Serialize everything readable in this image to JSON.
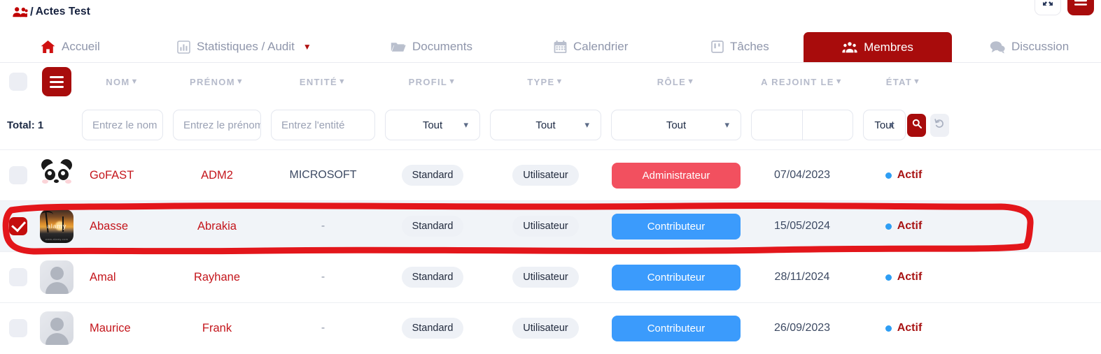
{
  "breadcrumb": {
    "icon": "group-icon",
    "separator": "/",
    "title": "Actes Test"
  },
  "topbar_actions": [
    {
      "name": "fullscreen-button",
      "icon": "expand-arrows-icon"
    },
    {
      "name": "menu-button",
      "icon": "hamburger-icon"
    }
  ],
  "nav": {
    "tabs": [
      {
        "label": "Accueil",
        "icon": "home-icon",
        "active": false,
        "caret": false
      },
      {
        "label": "Statistiques / Audit",
        "icon": "chart-bar-icon",
        "active": false,
        "caret": true
      },
      {
        "label": "Documents",
        "icon": "folder-icon",
        "active": false,
        "caret": false
      },
      {
        "label": "Calendrier",
        "icon": "calendar-icon",
        "active": false,
        "caret": false
      },
      {
        "label": "Tâches",
        "icon": "tasks-icon",
        "active": false,
        "caret": false
      },
      {
        "label": "Membres",
        "icon": "members-icon",
        "active": true,
        "caret": false
      },
      {
        "label": "Discussion",
        "icon": "chat-icon",
        "active": false,
        "caret": false
      }
    ],
    "active_tab_color": "#a80c0c"
  },
  "table": {
    "total_label": "Total: 1",
    "menu_button": "hamburger-icon",
    "columns": [
      {
        "label": "NOM",
        "sortable": true
      },
      {
        "label": "PRÉNOM",
        "sortable": true
      },
      {
        "label": "ENTITÉ",
        "sortable": true
      },
      {
        "label": "PROFIL",
        "sortable": true
      },
      {
        "label": "TYPE",
        "sortable": true
      },
      {
        "label": "RÔLE",
        "sortable": true
      },
      {
        "label": "A REJOINT LE",
        "sortable": true
      },
      {
        "label": "ÉTAT",
        "sortable": true
      }
    ],
    "filters": {
      "nom_placeholder": "Entrez le nom",
      "prenom_placeholder": "Entrez le prénom",
      "entite_placeholder": "Entrez l'entité",
      "profil_value": "Tout",
      "type_value": "Tout",
      "role_value": "Tout",
      "date_from": "",
      "date_to": "",
      "etat_value": "Tout",
      "search_button": "search-icon",
      "reset_button": "undo-icon"
    },
    "rows": [
      {
        "checked": false,
        "avatar": "panda-avatar",
        "nom": "GoFAST",
        "prenom": "ADM2",
        "entite": "MICROSOFT",
        "profil": "Standard",
        "type": "Utilisateur",
        "role": "Administrateur",
        "role_style": "admin",
        "joined": "07/04/2023",
        "etat": "Actif"
      },
      {
        "checked": true,
        "avatar": "sunset-avatar",
        "nom": "Abasse",
        "prenom": "Abrakia",
        "entite": "-",
        "profil": "Standard",
        "type": "Utilisateur",
        "role": "Contributeur",
        "role_style": "contrib",
        "joined": "15/05/2024",
        "etat": "Actif"
      },
      {
        "checked": false,
        "avatar": "person-avatar",
        "nom": "Amal",
        "prenom": "Rayhane",
        "entite": "-",
        "profil": "Standard",
        "type": "Utilisateur",
        "role": "Contributeur",
        "role_style": "contrib",
        "joined": "28/11/2024",
        "etat": "Actif"
      },
      {
        "checked": false,
        "avatar": "person-avatar",
        "nom": "Maurice",
        "prenom": "Frank",
        "entite": "-",
        "profil": "Standard",
        "type": "Utilisateur",
        "role": "Contributeur",
        "role_style": "contrib",
        "joined": "26/09/2023",
        "etat": "Actif"
      }
    ]
  },
  "annotation": {
    "shape": "hand-drawn-rounded-rectangle",
    "color": "#e3161b",
    "target_row": "Abasse"
  },
  "colors": {
    "brand_dark_red": "#a80c0c",
    "name_red": "#c4161c",
    "admin_coral": "#f2505f",
    "contrib_blue": "#3b9bfc",
    "state_dot_blue": "#2e9ef4",
    "header_gray": "#b6bbcb",
    "selected_row_bg": "#f1f4f8"
  },
  "sunset_avatar_watermark": {
    "line1": "alamy",
    "line2": "www.alamy.com"
  }
}
